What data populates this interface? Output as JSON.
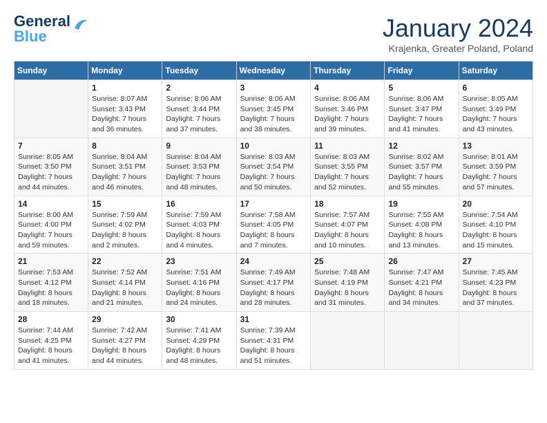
{
  "header": {
    "logo_line1": "General",
    "logo_line2": "Blue",
    "month_title": "January 2024",
    "location": "Krajenka, Greater Poland, Poland"
  },
  "weekdays": [
    "Sunday",
    "Monday",
    "Tuesday",
    "Wednesday",
    "Thursday",
    "Friday",
    "Saturday"
  ],
  "weeks": [
    [
      {
        "day": "",
        "info": ""
      },
      {
        "day": "1",
        "info": "Sunrise: 8:07 AM\nSunset: 3:43 PM\nDaylight: 7 hours\nand 36 minutes."
      },
      {
        "day": "2",
        "info": "Sunrise: 8:06 AM\nSunset: 3:44 PM\nDaylight: 7 hours\nand 37 minutes."
      },
      {
        "day": "3",
        "info": "Sunrise: 8:06 AM\nSunset: 3:45 PM\nDaylight: 7 hours\nand 38 minutes."
      },
      {
        "day": "4",
        "info": "Sunrise: 8:06 AM\nSunset: 3:46 PM\nDaylight: 7 hours\nand 39 minutes."
      },
      {
        "day": "5",
        "info": "Sunrise: 8:06 AM\nSunset: 3:47 PM\nDaylight: 7 hours\nand 41 minutes."
      },
      {
        "day": "6",
        "info": "Sunrise: 8:05 AM\nSunset: 3:49 PM\nDaylight: 7 hours\nand 43 minutes."
      }
    ],
    [
      {
        "day": "7",
        "info": "Sunrise: 8:05 AM\nSunset: 3:50 PM\nDaylight: 7 hours\nand 44 minutes."
      },
      {
        "day": "8",
        "info": "Sunrise: 8:04 AM\nSunset: 3:51 PM\nDaylight: 7 hours\nand 46 minutes."
      },
      {
        "day": "9",
        "info": "Sunrise: 8:04 AM\nSunset: 3:53 PM\nDaylight: 7 hours\nand 48 minutes."
      },
      {
        "day": "10",
        "info": "Sunrise: 8:03 AM\nSunset: 3:54 PM\nDaylight: 7 hours\nand 50 minutes."
      },
      {
        "day": "11",
        "info": "Sunrise: 8:03 AM\nSunset: 3:55 PM\nDaylight: 7 hours\nand 52 minutes."
      },
      {
        "day": "12",
        "info": "Sunrise: 8:02 AM\nSunset: 3:57 PM\nDaylight: 7 hours\nand 55 minutes."
      },
      {
        "day": "13",
        "info": "Sunrise: 8:01 AM\nSunset: 3:59 PM\nDaylight: 7 hours\nand 57 minutes."
      }
    ],
    [
      {
        "day": "14",
        "info": "Sunrise: 8:00 AM\nSunset: 4:00 PM\nDaylight: 7 hours\nand 59 minutes."
      },
      {
        "day": "15",
        "info": "Sunrise: 7:59 AM\nSunset: 4:02 PM\nDaylight: 8 hours\nand 2 minutes."
      },
      {
        "day": "16",
        "info": "Sunrise: 7:59 AM\nSunset: 4:03 PM\nDaylight: 8 hours\nand 4 minutes."
      },
      {
        "day": "17",
        "info": "Sunrise: 7:58 AM\nSunset: 4:05 PM\nDaylight: 8 hours\nand 7 minutes."
      },
      {
        "day": "18",
        "info": "Sunrise: 7:57 AM\nSunset: 4:07 PM\nDaylight: 8 hours\nand 10 minutes."
      },
      {
        "day": "19",
        "info": "Sunrise: 7:55 AM\nSunset: 4:08 PM\nDaylight: 8 hours\nand 13 minutes."
      },
      {
        "day": "20",
        "info": "Sunrise: 7:54 AM\nSunset: 4:10 PM\nDaylight: 8 hours\nand 15 minutes."
      }
    ],
    [
      {
        "day": "21",
        "info": "Sunrise: 7:53 AM\nSunset: 4:12 PM\nDaylight: 8 hours\nand 18 minutes."
      },
      {
        "day": "22",
        "info": "Sunrise: 7:52 AM\nSunset: 4:14 PM\nDaylight: 8 hours\nand 21 minutes."
      },
      {
        "day": "23",
        "info": "Sunrise: 7:51 AM\nSunset: 4:16 PM\nDaylight: 8 hours\nand 24 minutes."
      },
      {
        "day": "24",
        "info": "Sunrise: 7:49 AM\nSunset: 4:17 PM\nDaylight: 8 hours\nand 28 minutes."
      },
      {
        "day": "25",
        "info": "Sunrise: 7:48 AM\nSunset: 4:19 PM\nDaylight: 8 hours\nand 31 minutes."
      },
      {
        "day": "26",
        "info": "Sunrise: 7:47 AM\nSunset: 4:21 PM\nDaylight: 8 hours\nand 34 minutes."
      },
      {
        "day": "27",
        "info": "Sunrise: 7:45 AM\nSunset: 4:23 PM\nDaylight: 8 hours\nand 37 minutes."
      }
    ],
    [
      {
        "day": "28",
        "info": "Sunrise: 7:44 AM\nSunset: 4:25 PM\nDaylight: 8 hours\nand 41 minutes."
      },
      {
        "day": "29",
        "info": "Sunrise: 7:42 AM\nSunset: 4:27 PM\nDaylight: 8 hours\nand 44 minutes."
      },
      {
        "day": "30",
        "info": "Sunrise: 7:41 AM\nSunset: 4:29 PM\nDaylight: 8 hours\nand 48 minutes."
      },
      {
        "day": "31",
        "info": "Sunrise: 7:39 AM\nSunset: 4:31 PM\nDaylight: 8 hours\nand 51 minutes."
      },
      {
        "day": "",
        "info": ""
      },
      {
        "day": "",
        "info": ""
      },
      {
        "day": "",
        "info": ""
      }
    ]
  ]
}
